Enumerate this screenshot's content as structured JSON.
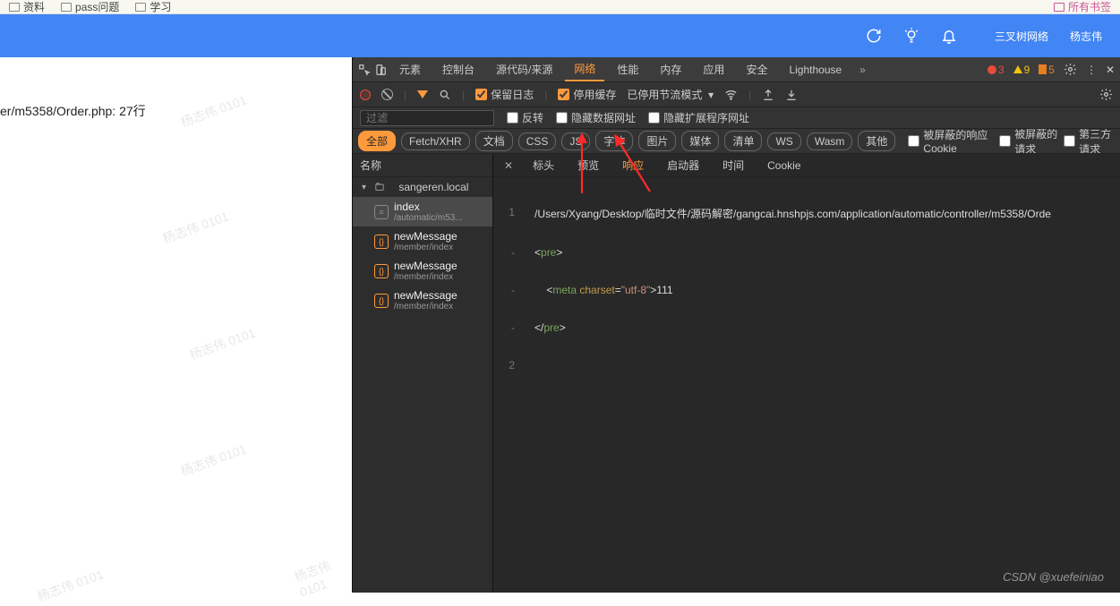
{
  "bookmarks": {
    "left": [
      "资料",
      "pass问题",
      "学习"
    ],
    "right": "所有书签"
  },
  "browser_bar": {
    "brand": "三叉树网络",
    "user": "杨志伟"
  },
  "left_pane": {
    "status": "er/m5358/Order.php:  27行"
  },
  "watermarks": [
    "杨志伟 0101",
    "杨志伟 0101",
    "杨志伟 0101",
    "杨志伟 0101",
    "杨志伟 0101",
    "杨志伟 0101"
  ],
  "devtools": {
    "tabs": [
      "元素",
      "控制台",
      "源代码/来源",
      "网络",
      "性能",
      "内存",
      "应用",
      "安全",
      "Lighthouse"
    ],
    "active_tab": "网络",
    "counts": {
      "errors": "3",
      "warnings": "9",
      "issues": "5"
    },
    "toolbar": {
      "preserve": "保留日志",
      "disable_cache": "停用缓存",
      "throttle": "已停用节流模式"
    },
    "filterbar": {
      "placeholder": "过滤",
      "invert": "反转",
      "hide_data": "隐藏数据网址",
      "hide_ext": "隐藏扩展程序网址"
    },
    "pills": [
      "全部",
      "Fetch/XHR",
      "文档",
      "CSS",
      "JS",
      "字体",
      "图片",
      "媒体",
      "清单",
      "WS",
      "Wasm",
      "其他"
    ],
    "active_pill": "全部",
    "extras": [
      "被屏蔽的响应 Cookie",
      "被屏蔽的请求",
      "第三方请求"
    ],
    "list_header": "名称",
    "domain": "sangeren.local",
    "requests": [
      {
        "name": "index",
        "path": "/automatic/m53...",
        "type": "doc",
        "selected": true
      },
      {
        "name": "newMessage",
        "path": "/member/index",
        "type": "xhr"
      },
      {
        "name": "newMessage",
        "path": "/member/index",
        "type": "xhr"
      },
      {
        "name": "newMessage",
        "path": "/member/index",
        "type": "xhr"
      }
    ],
    "detail_tabs": [
      "标头",
      "预览",
      "响应",
      "启动器",
      "时间",
      "Cookie"
    ],
    "active_detail_tab": "响应",
    "response": {
      "line1_path": "/Users/Xyang/Desktop/临时文件/源码解密/gangcai.hnshpjs.com/application/automatic/controller/m5358/Orde",
      "meta_text": "111"
    }
  },
  "footer": "CSDN @xuefeiniao"
}
